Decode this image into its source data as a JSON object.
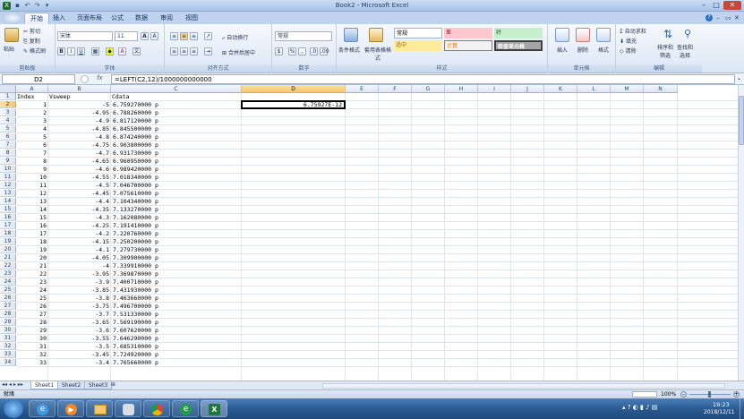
{
  "window": {
    "title": "Book2 - Microsoft Excel"
  },
  "quick_access": [
    "save-icon",
    "undo-icon",
    "redo-icon",
    "customize-icon"
  ],
  "ribbon_tabs": [
    "开始",
    "插入",
    "页面布局",
    "公式",
    "数据",
    "审阅",
    "视图"
  ],
  "ribbon": {
    "clipboard": {
      "paste": "粘贴",
      "cut": "剪切",
      "copy": "复制",
      "format_painter": "格式刷",
      "label": "剪贴板"
    },
    "font": {
      "name": "宋体",
      "size": "11",
      "bold": "B",
      "italic": "I",
      "underline": "U",
      "grow": "A",
      "shrink": "A",
      "label": "字体"
    },
    "alignment": {
      "wrap": "自动换行",
      "merge": "合并后居中",
      "label": "对齐方式"
    },
    "number": {
      "format": "常规",
      "percent": "%",
      "comma": ",",
      "label": "数字"
    },
    "styles": {
      "conditional": "条件格式",
      "table": "套用表格格式",
      "cells_styles": [
        {
          "text": "常规",
          "bg": "#ffffff",
          "fg": "#000000"
        },
        {
          "text": "差",
          "bg": "#ffc7ce",
          "fg": "#9c0006"
        },
        {
          "text": "好",
          "bg": "#c6efce",
          "fg": "#006100"
        },
        {
          "text": "适中",
          "bg": "#ffeb9c",
          "fg": "#9c6500"
        },
        {
          "text": "计算",
          "bg": "#f2f2f2",
          "fg": "#fa7d00"
        },
        {
          "text": "检查单元格",
          "bg": "#a5a5a5",
          "fg": "#ffffff"
        }
      ],
      "label": "样式"
    },
    "cells": {
      "insert": "插入",
      "delete": "删除",
      "format": "格式",
      "label": "单元格"
    },
    "editing": {
      "autosum": "自动求和",
      "fill": "填充",
      "clear": "清除",
      "sort": "排序和筛选",
      "find": "查找和选择",
      "label": "编辑"
    }
  },
  "formula_bar": {
    "name_box": "D2",
    "fx": "fx",
    "formula": "=LEFT(C2,12)/1000000000000"
  },
  "columns": [
    "A",
    "B",
    "C",
    "D",
    "E",
    "F",
    "G",
    "H",
    "I",
    "J",
    "K",
    "L",
    "M",
    "N"
  ],
  "selected_cell": {
    "col": "D",
    "row": "2",
    "value": "6.75927E-12"
  },
  "header_row": {
    "A": "Index",
    "B": "Vsweep",
    "C": "Cdata"
  },
  "rows": [
    {
      "r": "2",
      "a": "1",
      "b": "-5",
      "c": "6.759270000 p"
    },
    {
      "r": "3",
      "a": "2",
      "b": "-4.95",
      "c": "6.788260000 p"
    },
    {
      "r": "4",
      "a": "3",
      "b": "-4.9",
      "c": "6.817120000 p"
    },
    {
      "r": "5",
      "a": "4",
      "b": "-4.85",
      "c": "6.845500000 p"
    },
    {
      "r": "6",
      "a": "5",
      "b": "-4.8",
      "c": "6.874240000 p"
    },
    {
      "r": "7",
      "a": "6",
      "b": "-4.75",
      "c": "6.903800000 p"
    },
    {
      "r": "8",
      "a": "7",
      "b": "-4.7",
      "c": "6.931730000 p"
    },
    {
      "r": "9",
      "a": "8",
      "b": "-4.65",
      "c": "6.960950000 p"
    },
    {
      "r": "10",
      "a": "9",
      "b": "-4.6",
      "c": "6.989420000 p"
    },
    {
      "r": "11",
      "a": "10",
      "b": "-4.55",
      "c": "7.018340000 p"
    },
    {
      "r": "12",
      "a": "11",
      "b": "-4.5",
      "c": "7.046700000 p"
    },
    {
      "r": "13",
      "a": "12",
      "b": "-4.45",
      "c": "7.075610000 p"
    },
    {
      "r": "14",
      "a": "13",
      "b": "-4.4",
      "c": "7.104340000 p"
    },
    {
      "r": "15",
      "a": "14",
      "b": "-4.35",
      "c": "7.133270000 p"
    },
    {
      "r": "16",
      "a": "15",
      "b": "-4.3",
      "c": "7.162080000 p"
    },
    {
      "r": "17",
      "a": "16",
      "b": "-4.25",
      "c": "7.191410000 p"
    },
    {
      "r": "18",
      "a": "17",
      "b": "-4.2",
      "c": "7.220760000 p"
    },
    {
      "r": "19",
      "a": "18",
      "b": "-4.15",
      "c": "7.250200000 p"
    },
    {
      "r": "20",
      "a": "19",
      "b": "-4.1",
      "c": "7.279730000 p"
    },
    {
      "r": "21",
      "a": "20",
      "b": "-4.05",
      "c": "7.309900000 p"
    },
    {
      "r": "22",
      "a": "21",
      "b": "-4",
      "c": "7.339910000 p"
    },
    {
      "r": "23",
      "a": "22",
      "b": "-3.95",
      "c": "7.369870000 p"
    },
    {
      "r": "24",
      "a": "23",
      "b": "-3.9",
      "c": "7.400710000 p"
    },
    {
      "r": "25",
      "a": "24",
      "b": "-3.85",
      "c": "7.431930000 p"
    },
    {
      "r": "26",
      "a": "25",
      "b": "-3.8",
      "c": "7.463660000 p"
    },
    {
      "r": "27",
      "a": "26",
      "b": "-3.75",
      "c": "7.496700000 p"
    },
    {
      "r": "28",
      "a": "27",
      "b": "-3.7",
      "c": "7.531330000 p"
    },
    {
      "r": "29",
      "a": "28",
      "b": "-3.65",
      "c": "7.569190000 p"
    },
    {
      "r": "30",
      "a": "29",
      "b": "-3.6",
      "c": "7.607620000 p"
    },
    {
      "r": "31",
      "a": "30",
      "b": "-3.55",
      "c": "7.646290000 p"
    },
    {
      "r": "32",
      "a": "31",
      "b": "-3.5",
      "c": "7.685310000 p"
    },
    {
      "r": "33",
      "a": "32",
      "b": "-3.45",
      "c": "7.724920000 p"
    },
    {
      "r": "34",
      "a": "33",
      "b": "-3.4",
      "c": "7.765660000 p"
    }
  ],
  "sheet_tabs": [
    "Sheet1",
    "Sheet2",
    "Sheet3"
  ],
  "status": {
    "ready": "就绪",
    "zoom": "100%"
  },
  "taskbar": {
    "time": "19:23",
    "date": "2018/12/11"
  }
}
